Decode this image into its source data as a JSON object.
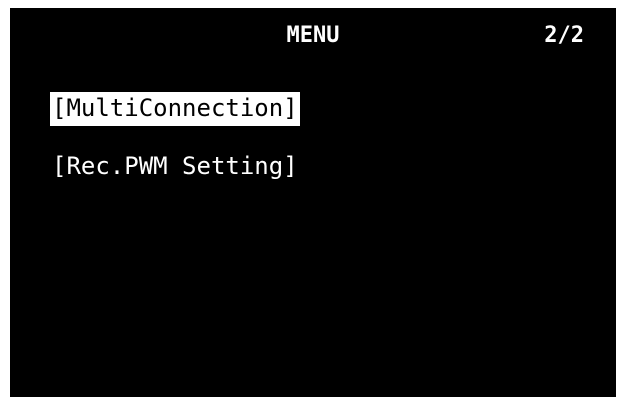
{
  "header": {
    "title": "MENU",
    "page_indicator": "2/2"
  },
  "menu": {
    "items": [
      {
        "label": "MultiConnection",
        "selected": true
      },
      {
        "label": "Rec.PWM Setting",
        "selected": false
      }
    ]
  },
  "colors": {
    "background": "#000000",
    "text": "#ffffff",
    "highlight": "#ffffff"
  }
}
